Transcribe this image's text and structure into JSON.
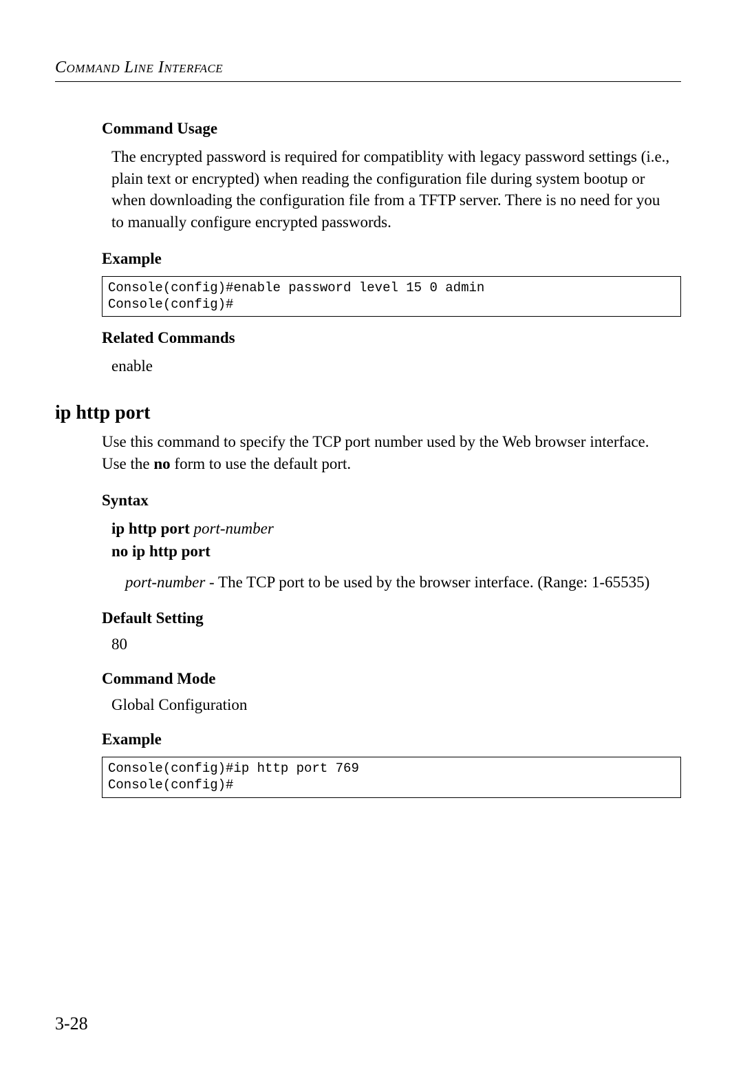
{
  "header": "Command Line Interface",
  "sections": {
    "usage": {
      "title": "Command Usage",
      "text": "The encrypted password is required for compatiblity with legacy password settings (i.e., plain text or encrypted) when reading the configuration file during system bootup or when downloading the configuration file from a TFTP server. There is no need for you to manually configure encrypted passwords."
    },
    "example1": {
      "title": "Example",
      "code": "Console(config)#enable password level 15 0 admin\nConsole(config)#"
    },
    "related": {
      "title": "Related Commands",
      "text": "enable"
    },
    "commandTitle": "ip http port",
    "commandDesc": {
      "pre": "Use this command to specify the TCP port number used by the Web browser interface. Use the ",
      "bold": "no",
      "post": " form to use the default port."
    },
    "syntax": {
      "title": "Syntax",
      "line1": {
        "bold": "ip http port ",
        "italic": "port-number"
      },
      "line2": "no ip http port",
      "param": {
        "italic": "port-number",
        "rest": " - The TCP port to be used by the browser interface. (Range: 1-65535)"
      }
    },
    "default": {
      "title": "Default Setting",
      "value": "80"
    },
    "mode": {
      "title": "Command Mode",
      "value": "Global Configuration"
    },
    "example2": {
      "title": "Example",
      "code": "Console(config)#ip http port 769\nConsole(config)#"
    }
  },
  "pageNumber": "3-28"
}
